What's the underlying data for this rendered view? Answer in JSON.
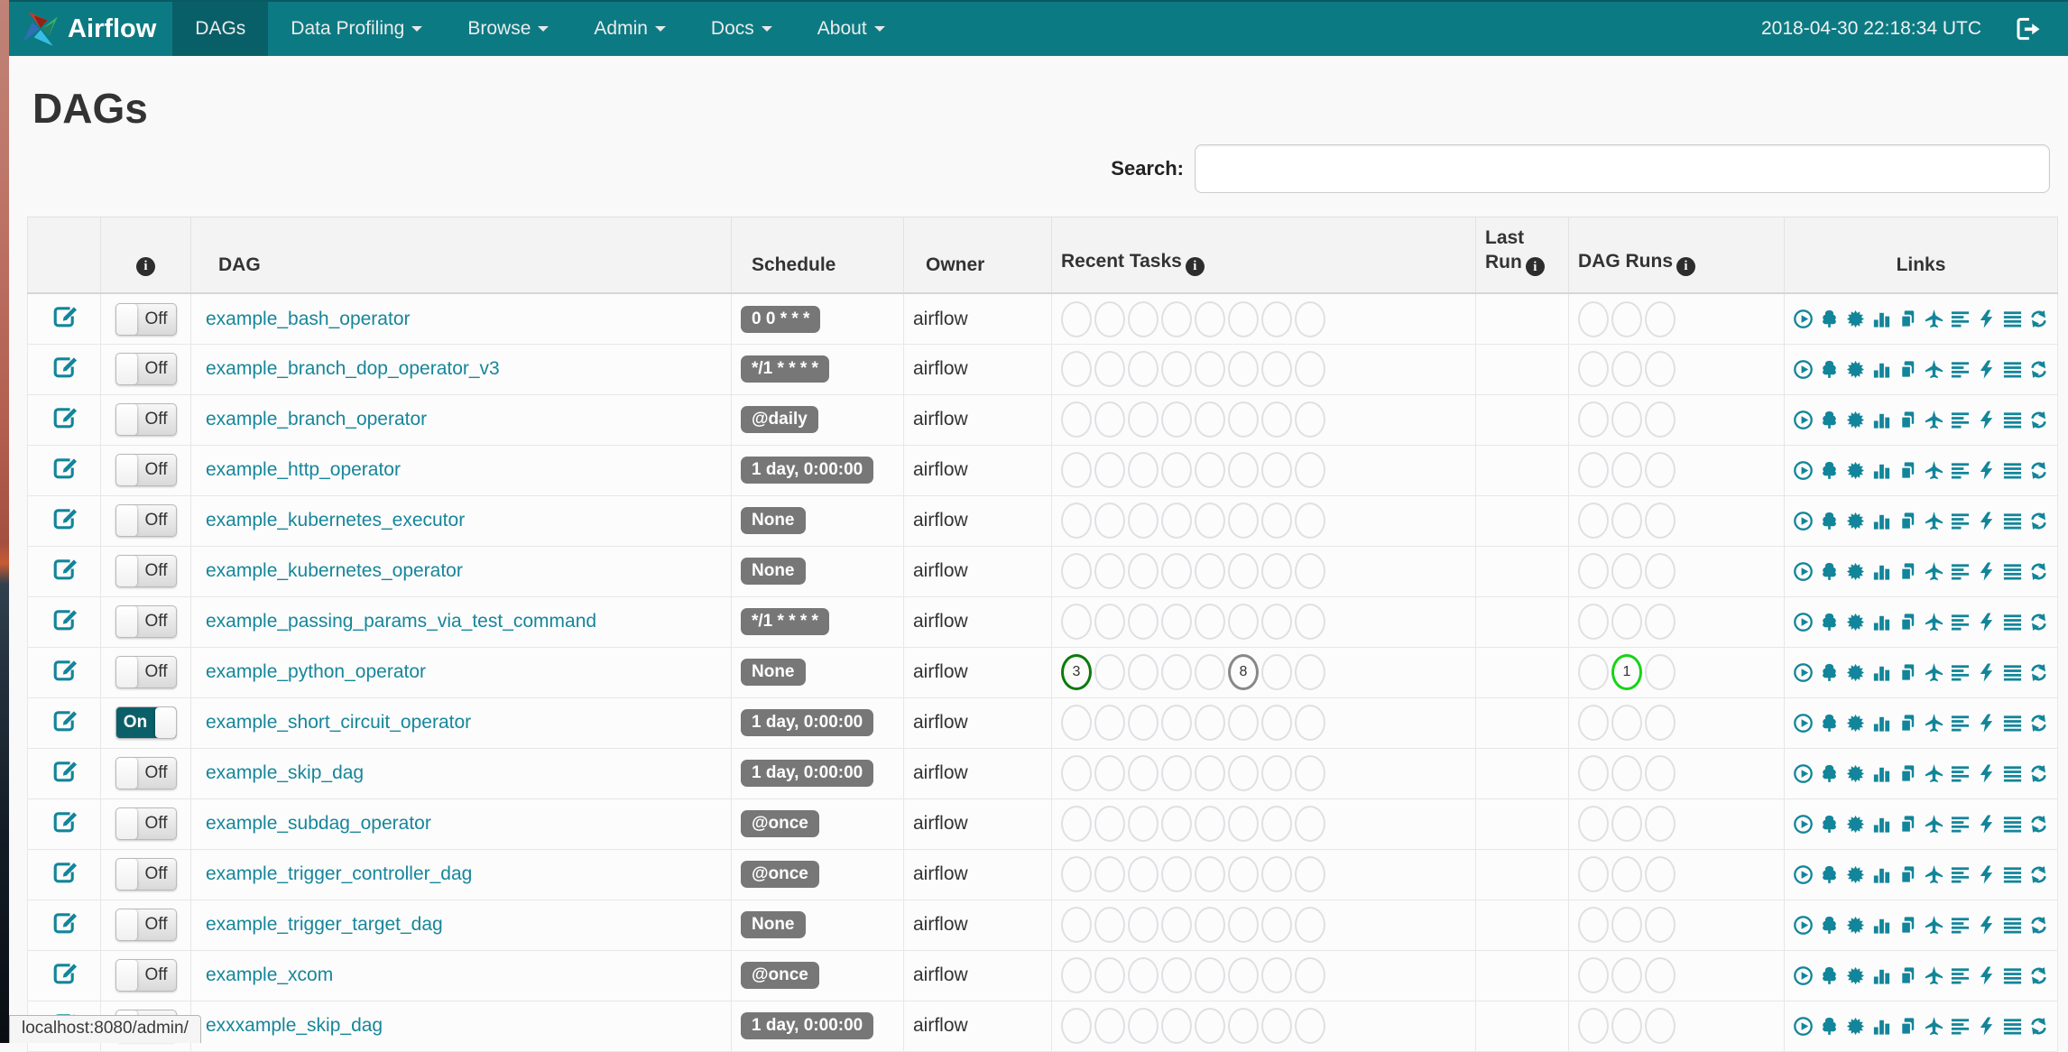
{
  "navbar": {
    "brand": "Airflow",
    "items": [
      {
        "label": "DAGs",
        "active": true,
        "caret": false
      },
      {
        "label": "Data Profiling",
        "active": false,
        "caret": true
      },
      {
        "label": "Browse",
        "active": false,
        "caret": true
      },
      {
        "label": "Admin",
        "active": false,
        "caret": true
      },
      {
        "label": "Docs",
        "active": false,
        "caret": true
      },
      {
        "label": "About",
        "active": false,
        "caret": true
      }
    ],
    "clock": "2018-04-30 22:18:34 UTC"
  },
  "page": {
    "title": "DAGs",
    "search_label": "Search:",
    "search_value": "",
    "status_bar": "localhost:8080/admin/"
  },
  "icons": {
    "info_glyph": "i"
  },
  "colors": {
    "navbar": "#0c7a83",
    "navbar_active": "#095f68",
    "link": "#17869a",
    "icon": "#12859a",
    "badge_bg": "#777777",
    "toggle_on_bg": "#0b5f68",
    "circle_empty": "#e0e0e4"
  },
  "table": {
    "headers": {
      "dag": "DAG",
      "schedule": "Schedule",
      "owner": "Owner",
      "recent_tasks": "Recent Tasks",
      "last_run_line1": "Last",
      "last_run_line2": "Run",
      "dag_runs": "DAG Runs",
      "links": "Links"
    },
    "recent_task_slots": 8,
    "dag_run_slots": 3,
    "links": [
      {
        "name": "trigger-dag-link",
        "icon": "play-circle-icon",
        "sym": "i-play"
      },
      {
        "name": "tree-view-link",
        "icon": "tree-icon",
        "sym": "i-tree"
      },
      {
        "name": "graph-view-link",
        "icon": "starburst-icon",
        "sym": "i-graph"
      },
      {
        "name": "task-duration-link",
        "icon": "bar-chart-icon",
        "sym": "i-stats"
      },
      {
        "name": "task-tries-link",
        "icon": "duplicate-pages-icon",
        "sym": "i-dup"
      },
      {
        "name": "landing-times-link",
        "icon": "plane-icon",
        "sym": "i-plane"
      },
      {
        "name": "gantt-view-link",
        "icon": "align-left-icon",
        "sym": "i-gantt"
      },
      {
        "name": "code-view-link",
        "icon": "lightning-icon",
        "sym": "i-flash"
      },
      {
        "name": "dag-details-link",
        "icon": "align-justify-icon",
        "sym": "i-justify"
      },
      {
        "name": "refresh-link",
        "icon": "refresh-icon",
        "sym": "i-refresh"
      }
    ],
    "rows": [
      {
        "dag_id": "example_bash_operator",
        "toggle": "Off",
        "schedule": "0 0 * * *",
        "owner": "airflow",
        "recent_tasks": [],
        "dag_runs": []
      },
      {
        "dag_id": "example_branch_dop_operator_v3",
        "toggle": "Off",
        "schedule": "*/1 * * * *",
        "owner": "airflow",
        "recent_tasks": [],
        "dag_runs": []
      },
      {
        "dag_id": "example_branch_operator",
        "toggle": "Off",
        "schedule": "@daily",
        "owner": "airflow",
        "recent_tasks": [],
        "dag_runs": []
      },
      {
        "dag_id": "example_http_operator",
        "toggle": "Off",
        "schedule": "1 day, 0:00:00",
        "owner": "airflow",
        "recent_tasks": [],
        "dag_runs": []
      },
      {
        "dag_id": "example_kubernetes_executor",
        "toggle": "Off",
        "schedule": "None",
        "owner": "airflow",
        "recent_tasks": [],
        "dag_runs": []
      },
      {
        "dag_id": "example_kubernetes_operator",
        "toggle": "Off",
        "schedule": "None",
        "owner": "airflow",
        "recent_tasks": [],
        "dag_runs": []
      },
      {
        "dag_id": "example_passing_params_via_test_command",
        "toggle": "Off",
        "schedule": "*/1 * * * *",
        "owner": "airflow",
        "recent_tasks": [],
        "dag_runs": []
      },
      {
        "dag_id": "example_python_operator",
        "toggle": "Off",
        "schedule": "None",
        "owner": "airflow",
        "recent_tasks": [
          {
            "slot": 1,
            "count": "3",
            "color": "#0a7a0a"
          },
          {
            "slot": 6,
            "count": "8",
            "color": "#888888"
          }
        ],
        "dag_runs": [
          {
            "slot": 2,
            "count": "1",
            "color": "#16d416"
          }
        ]
      },
      {
        "dag_id": "example_short_circuit_operator",
        "toggle": "On",
        "schedule": "1 day, 0:00:00",
        "owner": "airflow",
        "recent_tasks": [],
        "dag_runs": []
      },
      {
        "dag_id": "example_skip_dag",
        "toggle": "Off",
        "schedule": "1 day, 0:00:00",
        "owner": "airflow",
        "recent_tasks": [],
        "dag_runs": []
      },
      {
        "dag_id": "example_subdag_operator",
        "toggle": "Off",
        "schedule": "@once",
        "owner": "airflow",
        "recent_tasks": [],
        "dag_runs": []
      },
      {
        "dag_id": "example_trigger_controller_dag",
        "toggle": "Off",
        "schedule": "@once",
        "owner": "airflow",
        "recent_tasks": [],
        "dag_runs": []
      },
      {
        "dag_id": "example_trigger_target_dag",
        "toggle": "Off",
        "schedule": "None",
        "owner": "airflow",
        "recent_tasks": [],
        "dag_runs": []
      },
      {
        "dag_id": "example_xcom",
        "toggle": "Off",
        "schedule": "@once",
        "owner": "airflow",
        "recent_tasks": [],
        "dag_runs": []
      },
      {
        "dag_id": "exxxample_skip_dag",
        "toggle": "Off",
        "schedule": "1 day, 0:00:00",
        "owner": "airflow",
        "recent_tasks": [],
        "dag_runs": []
      }
    ]
  }
}
